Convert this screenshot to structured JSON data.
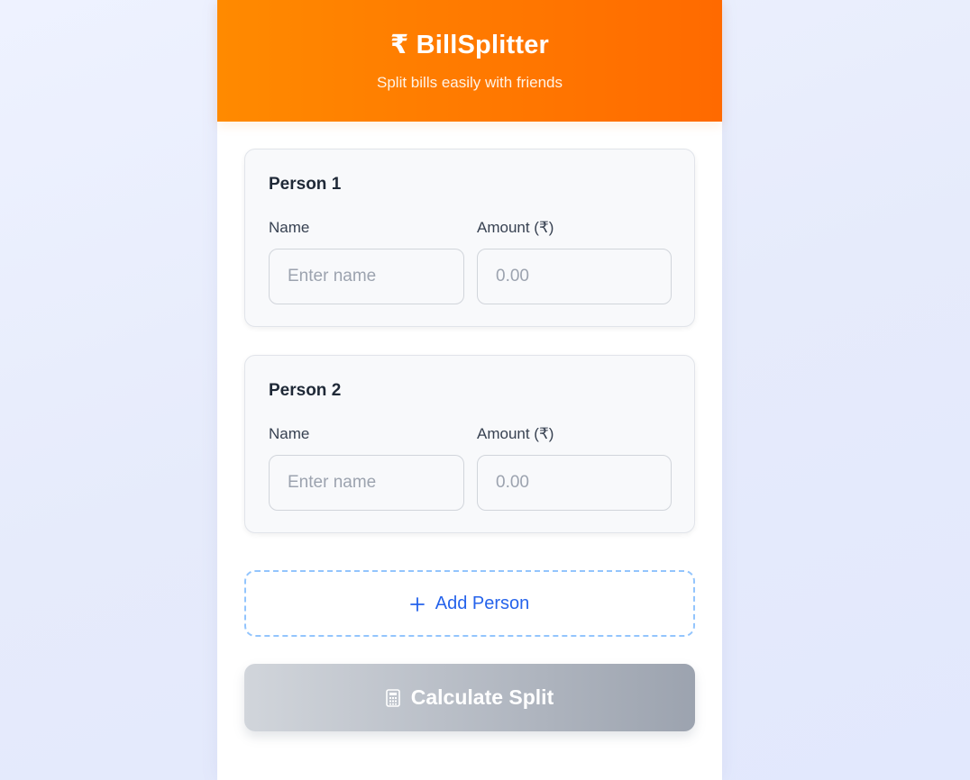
{
  "header": {
    "title": "₹ BillSplitter",
    "subtitle": "Split bills easily with friends"
  },
  "people": [
    {
      "title": "Person 1",
      "name_label": "Name",
      "name_placeholder": "Enter name",
      "name_value": "",
      "amount_label": "Amount (₹)",
      "amount_placeholder": "0.00",
      "amount_value": ""
    },
    {
      "title": "Person 2",
      "name_label": "Name",
      "name_placeholder": "Enter name",
      "name_value": "",
      "amount_label": "Amount (₹)",
      "amount_placeholder": "0.00",
      "amount_value": ""
    }
  ],
  "actions": {
    "add_icon": "plus-icon",
    "add_label": "Add Person",
    "calculate_icon": "calculator-icon",
    "calculate_label": "Calculate Split"
  },
  "colors": {
    "header_gradient_start": "#ff8a00",
    "header_gradient_end": "#ff6a00",
    "add_accent": "#2563eb",
    "add_border": "#93c5fd",
    "calculate_gradient_start": "#d1d5db",
    "calculate_gradient_end": "#9ca3af"
  }
}
